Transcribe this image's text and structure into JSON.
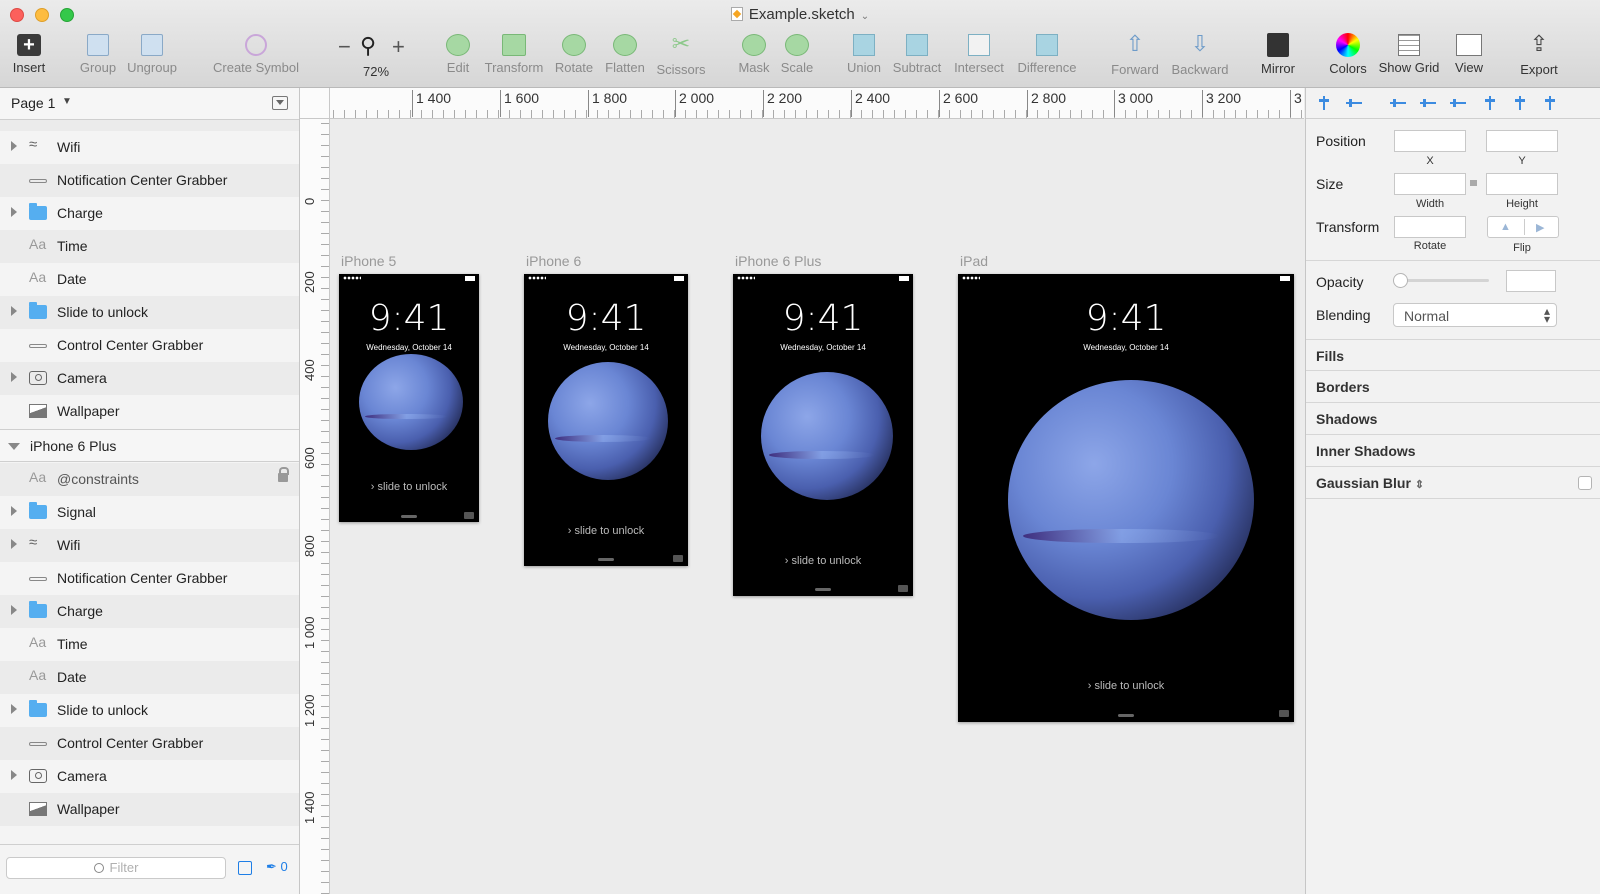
{
  "window": {
    "title": "Example.sketch"
  },
  "toolbar": {
    "insert": "Insert",
    "group": "Group",
    "ungroup": "Ungroup",
    "create_symbol": "Create Symbol",
    "zoom_value": "72%",
    "edit": "Edit",
    "transform": "Transform",
    "rotate": "Rotate",
    "flatten": "Flatten",
    "scissors": "Scissors",
    "mask": "Mask",
    "scale": "Scale",
    "union": "Union",
    "subtract": "Subtract",
    "intersect": "Intersect",
    "difference": "Difference",
    "forward": "Forward",
    "backward": "Backward",
    "mirror": "Mirror",
    "colors": "Colors",
    "show_grid": "Show Grid",
    "view": "View",
    "export": "Export"
  },
  "sidebar": {
    "page": "Page 1",
    "layers": [
      {
        "name": "Wifi",
        "icon": "wifi-icon"
      },
      {
        "name": "Notification Center Grabber",
        "icon": "line-icon"
      },
      {
        "name": "Charge",
        "icon": "folder-icon"
      },
      {
        "name": "Time",
        "icon": "text-icon"
      },
      {
        "name": "Date",
        "icon": "text-icon"
      },
      {
        "name": "Slide to unlock",
        "icon": "folder-icon"
      },
      {
        "name": "Control Center Grabber",
        "icon": "line-icon"
      },
      {
        "name": "Camera",
        "icon": "camera-icon"
      },
      {
        "name": "Wallpaper",
        "icon": "image-icon"
      },
      {
        "name": "iPhone 6 Plus",
        "icon": "artboard"
      },
      {
        "name": "@constraints",
        "icon": "text-icon"
      },
      {
        "name": "Signal",
        "icon": "folder-icon"
      },
      {
        "name": "Wifi",
        "icon": "wifi-icon"
      },
      {
        "name": "Notification Center Grabber",
        "icon": "line-icon"
      },
      {
        "name": "Charge",
        "icon": "folder-icon"
      },
      {
        "name": "Time",
        "icon": "text-icon"
      },
      {
        "name": "Date",
        "icon": "text-icon"
      },
      {
        "name": "Slide to unlock",
        "icon": "folder-icon"
      },
      {
        "name": "Control Center Grabber",
        "icon": "line-icon"
      },
      {
        "name": "Camera",
        "icon": "camera-icon"
      },
      {
        "name": "Wallpaper",
        "icon": "image-icon"
      }
    ],
    "text_glyph": "Aa",
    "filter_placeholder": "Filter",
    "edited_count": "0"
  },
  "rulers": {
    "horizontal": [
      "1 400",
      "1 600",
      "1 800",
      "2 000",
      "2 200",
      "2 400",
      "2 600",
      "2 800",
      "3 000",
      "3 200",
      "3"
    ],
    "vertical": [
      "0",
      "200",
      "400",
      "600",
      "800",
      "1 000",
      "1 200",
      "1 400"
    ]
  },
  "artboards": [
    {
      "title": "iPhone 5",
      "time": "9:41",
      "date": "Wednesday, October 14",
      "slide": "slide to unlock"
    },
    {
      "title": "iPhone 6",
      "time": "9:41",
      "date": "Wednesday, October 14",
      "slide": "slide to unlock"
    },
    {
      "title": "iPhone 6 Plus",
      "time": "9:41",
      "date": "Wednesday, October 14",
      "slide": "slide to unlock"
    },
    {
      "title": "iPad",
      "time": "9:41",
      "date": "Wednesday, October 14",
      "slide": "slide to unlock"
    }
  ],
  "inspector": {
    "position": "Position",
    "x": "X",
    "y": "Y",
    "size": "Size",
    "width": "Width",
    "height": "Height",
    "transform": "Transform",
    "rotate": "Rotate",
    "flip": "Flip",
    "opacity": "Opacity",
    "blending": "Blending",
    "blending_value": "Normal",
    "fills": "Fills",
    "borders": "Borders",
    "shadows": "Shadows",
    "inner_shadows": "Inner Shadows",
    "gaussian_blur": "Gaussian Blur"
  },
  "colors": {
    "accent": "#1e7ee6",
    "folder": "#55aef0",
    "artboard_bg": "#000000"
  }
}
